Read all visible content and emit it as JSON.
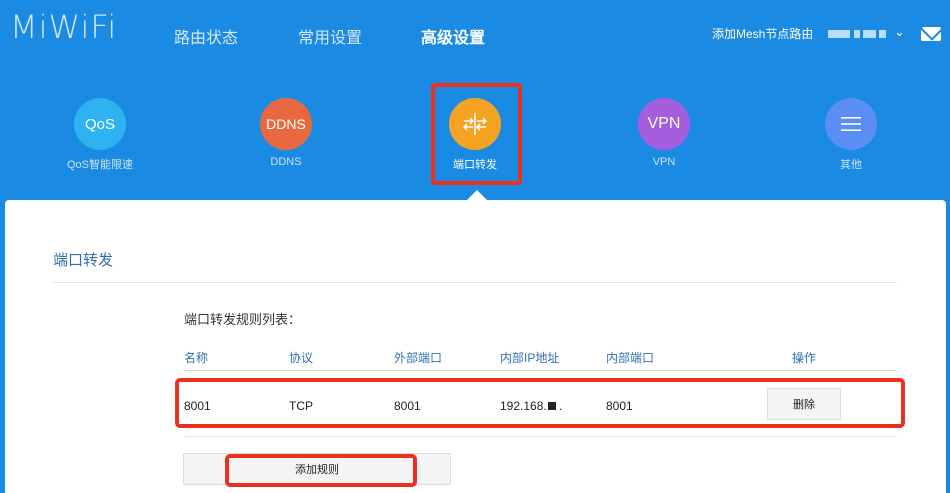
{
  "header": {
    "logo": "MiWiFi",
    "nav": [
      "路由状态",
      "常用设置",
      "高级设置"
    ],
    "active_nav_index": 2,
    "mesh_link": "添加Mesh节点路由",
    "icons": {
      "account_menu": "chevron-down-icon",
      "messages": "mail-icon"
    }
  },
  "features": [
    {
      "icon_text": "QoS",
      "label": "QoS智能限速",
      "color": "#2fb3f0"
    },
    {
      "icon_text": "DDNS",
      "label": "DDNS",
      "color": "#e8693f"
    },
    {
      "icon_text": "",
      "label": "端口转发",
      "color": "#f6a324",
      "icon": "port-forward-icon",
      "active": true
    },
    {
      "icon_text": "VPN",
      "label": "VPN",
      "color": "#a45ddc"
    },
    {
      "icon_text": "",
      "label": "其他",
      "color": "#5b8ef2",
      "icon": "menu-icon"
    }
  ],
  "panel": {
    "title": "端口转发",
    "list_title": "端口转发规则列表：",
    "columns": [
      "名称",
      "协议",
      "外部端口",
      "内部IP地址",
      "内部端口",
      "操作"
    ],
    "rows": [
      {
        "name": "8001",
        "protocol": "TCP",
        "external_port": "8001",
        "internal_ip": "192.168.",
        "internal_ip_suffix": ".",
        "internal_port": "8001",
        "action": "删除"
      }
    ],
    "add_button": "添加规则"
  },
  "colors": {
    "accent": "#1a8ae2",
    "highlight": "#e8321f",
    "link": "#2f6fb6"
  }
}
